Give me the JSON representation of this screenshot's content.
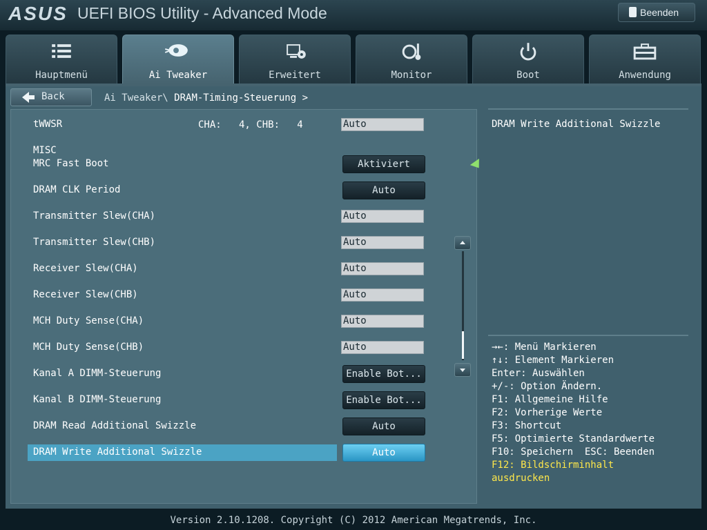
{
  "header": {
    "logo": "ASUS",
    "title": "UEFI BIOS Utility - Advanced Mode",
    "exit_label": "Beenden"
  },
  "tabs": [
    {
      "label": "Hauptmenü",
      "icon": "list-icon"
    },
    {
      "label": "Ai Tweaker",
      "icon": "tweaker-icon",
      "active": true
    },
    {
      "label": "Erweitert",
      "icon": "advanced-icon"
    },
    {
      "label": "Monitor",
      "icon": "monitor-icon"
    },
    {
      "label": "Boot",
      "icon": "power-icon"
    },
    {
      "label": "Anwendung",
      "icon": "toolbox-icon"
    }
  ],
  "nav": {
    "back_label": "Back",
    "breadcrumb_parent": "Ai Tweaker\\",
    "breadcrumb_current": "DRAM-Timing-Steuerung >"
  },
  "settings": {
    "twwsr": {
      "label": "tWWSR",
      "cha_info": "CHA:   4, CHB:   4",
      "value": "Auto"
    },
    "section_misc": "MISC",
    "rows": [
      {
        "label": "MRC Fast Boot",
        "value": "Aktiviert",
        "type": "button"
      },
      {
        "label": "DRAM CLK Period",
        "value": "Auto",
        "type": "button"
      },
      {
        "label": "Transmitter Slew(CHA)",
        "value": "Auto",
        "type": "input"
      },
      {
        "label": "Transmitter Slew(CHB)",
        "value": "Auto",
        "type": "input"
      },
      {
        "label": "Receiver Slew(CHA)",
        "value": "Auto",
        "type": "input"
      },
      {
        "label": "Receiver Slew(CHB)",
        "value": "Auto",
        "type": "input"
      },
      {
        "label": "MCH Duty Sense(CHA)",
        "value": "Auto",
        "type": "input"
      },
      {
        "label": "MCH Duty Sense(CHB)",
        "value": "Auto",
        "type": "input"
      },
      {
        "label": "Kanal A DIMM-Steuerung",
        "value": "Enable Bot...",
        "type": "button"
      },
      {
        "label": "Kanal B DIMM-Steuerung",
        "value": "Enable Bot...",
        "type": "button"
      },
      {
        "label": "DRAM Read Additional Swizzle",
        "value": "Auto",
        "type": "button"
      },
      {
        "label": "DRAM Write Additional Swizzle",
        "value": "Auto",
        "type": "button",
        "selected": true
      }
    ]
  },
  "help": {
    "title": "DRAM Write Additional Swizzle",
    "keys": [
      "→←: Menü Markieren",
      "↑↓: Element Markieren",
      "Enter: Auswählen",
      "+/-: Option Ändern.",
      "F1: Allgemeine Hilfe",
      "F2: Vorherige Werte",
      "F3: Shortcut",
      "F5: Optimierte Standardwerte",
      "F10: Speichern  ESC: Beenden"
    ],
    "highlight_line1": "F12: Bildschirminhalt",
    "highlight_line2": "ausdrucken"
  },
  "footer": "Version 2.10.1208. Copyright (C) 2012 American Megatrends, Inc.",
  "colors": {
    "accent": "#4ba3c4",
    "highlight_text": "#ffe84a",
    "panel": "#4b6d7a"
  }
}
